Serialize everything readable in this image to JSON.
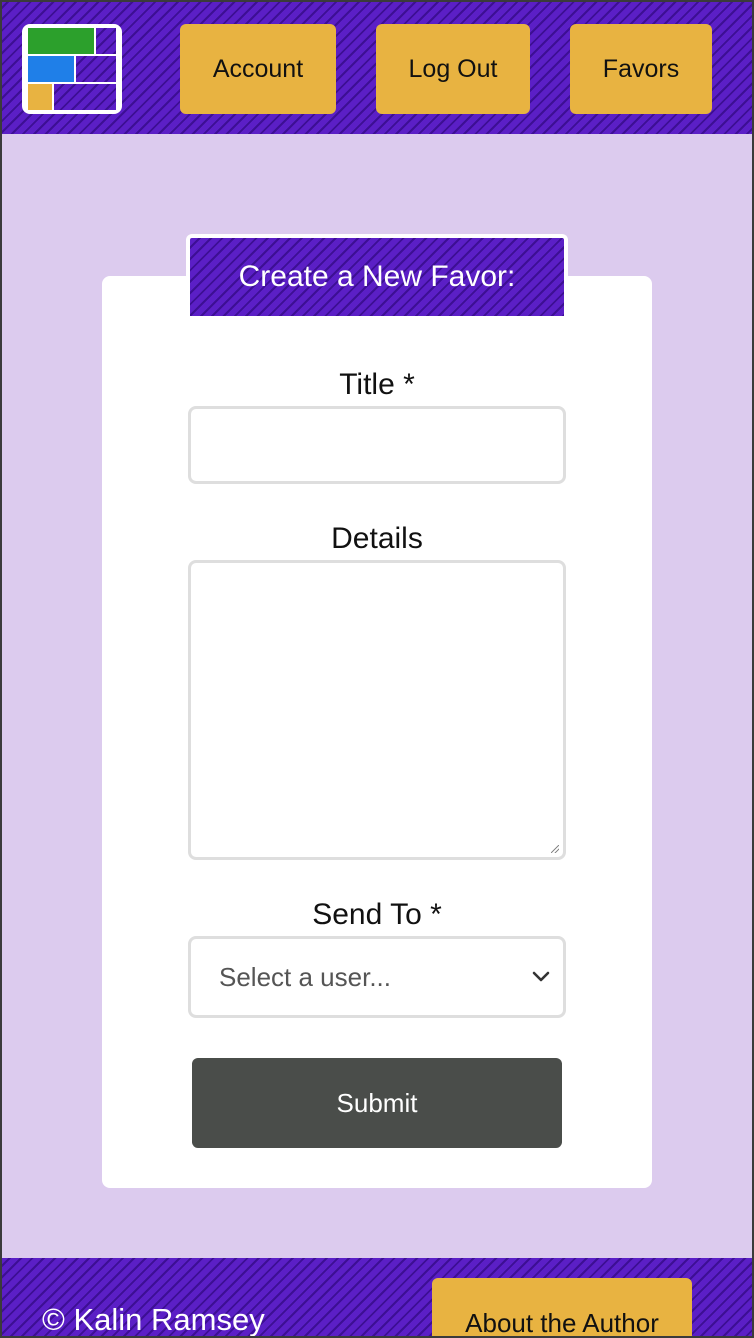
{
  "header": {
    "logo_icon": "favors-app-logo-icon",
    "nav": [
      {
        "label": "Account"
      },
      {
        "label": "Log Out"
      },
      {
        "label": "Favors"
      }
    ]
  },
  "form": {
    "title": "Create a New Favor:",
    "title_label": "Title *",
    "title_value": "",
    "details_label": "Details",
    "details_value": "",
    "send_to_label": "Send To *",
    "send_to_selected": "Select a user...",
    "submit_label": "Submit"
  },
  "footer": {
    "copyright": "© Kalin Ramsey",
    "about_label": "About the Author"
  },
  "colors": {
    "header_purple": "#5b1fc6",
    "button_gold": "#e8b341",
    "submit_dark": "#4a4d4a",
    "page_lavender": "#dccbee",
    "logo_green": "#2ca02c",
    "logo_blue": "#1f7fe8"
  }
}
